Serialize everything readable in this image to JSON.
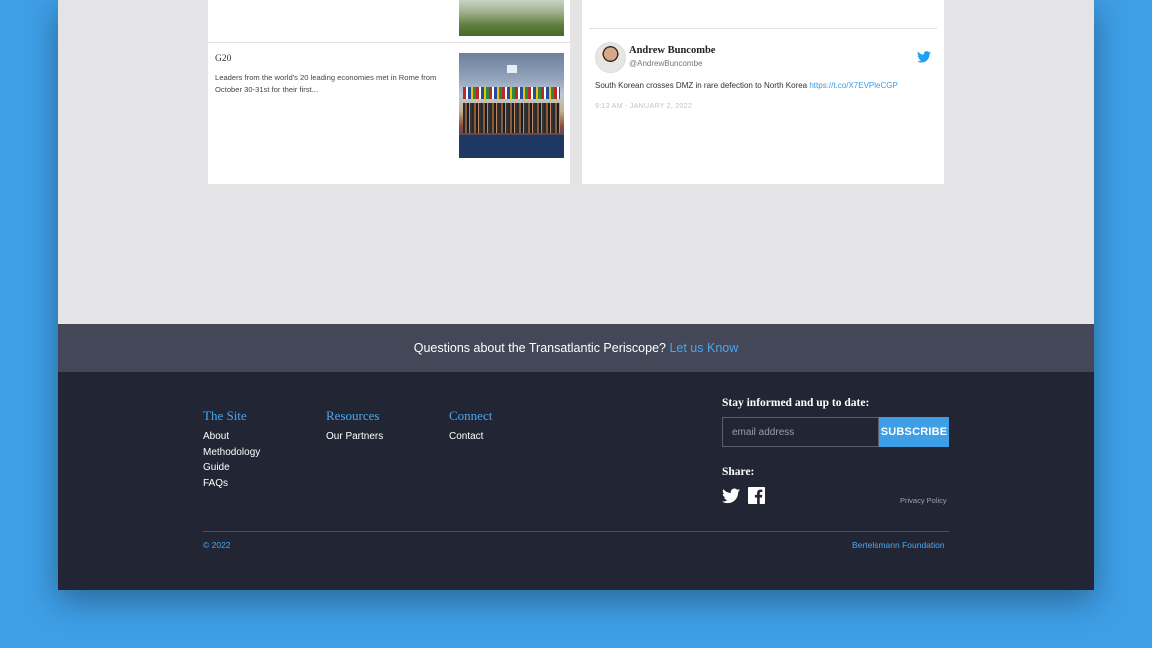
{
  "news": {
    "title": "G20",
    "description": "Leaders from the world's 20 leading economies met in Rome from October 30-31st for their first..."
  },
  "tweet": {
    "name": "Andrew Buncombe",
    "handle": "@AndrewBuncombe",
    "text": "South Korean crosses DMZ in rare defection to North Korea",
    "link": "https://t.co/X7EVPleCGP",
    "time": "9:13 AM - January 2, 2022"
  },
  "question_bar": {
    "text": "Questions about the Transatlantic Periscope?",
    "link": "Let us Know"
  },
  "footer": {
    "site": {
      "heading": "The Site",
      "items": [
        "About",
        "Methodology",
        "Guide",
        "FAQs"
      ]
    },
    "resources": {
      "heading": "Resources",
      "items": [
        "Our Partners"
      ]
    },
    "connect": {
      "heading": "Connect",
      "items": [
        "Contact"
      ]
    },
    "newsletter": {
      "label": "Stay informed and up to date:",
      "placeholder": "email address",
      "button": "SUBSCRIBE"
    },
    "share_label": "Share:",
    "privacy": "Privacy Policy",
    "copyright": "© 2022",
    "org": "Bertelsmann Foundation"
  },
  "colors": {
    "accent": "#3e9ee6",
    "footer_bg": "#222634",
    "bar_bg": "#434757",
    "page_bg": "#e4e4e6"
  },
  "icons": [
    "twitter-icon",
    "facebook-icon"
  ]
}
